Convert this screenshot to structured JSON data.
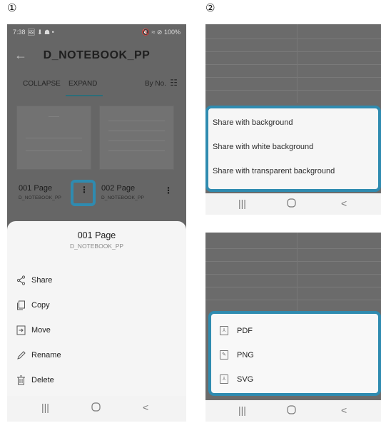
{
  "steps": {
    "one": "①",
    "two": "②"
  },
  "status_bar": {
    "time": "7:38",
    "left_icons": "🖼 ⬇ ☗ •",
    "right_info": "🔇 ≈ ⊘ 100%"
  },
  "app_bar": {
    "back_icon": "back-arrow-icon",
    "title": "D_NOTEBOOK_PP"
  },
  "tabs": {
    "collapse": "COLLAPSE",
    "expand": "EXPAND",
    "sort": "By No."
  },
  "pages": [
    {
      "title": "001 Page",
      "subtitle": "D_NOTEBOOK_PP"
    },
    {
      "title": "002 Page",
      "subtitle": "D_NOTEBOOK_PP"
    }
  ],
  "sheet": {
    "title": "001 Page",
    "subtitle": "D_NOTEBOOK_PP",
    "items": [
      {
        "label": "Share",
        "icon": "share-icon"
      },
      {
        "label": "Copy",
        "icon": "copy-icon"
      },
      {
        "label": "Move",
        "icon": "move-icon"
      },
      {
        "label": "Rename",
        "icon": "rename-icon"
      },
      {
        "label": "Delete",
        "icon": "delete-icon"
      }
    ]
  },
  "share_options": [
    "Share with background",
    "Share with white background",
    "Share with transparent background"
  ],
  "formats": [
    {
      "label": "PDF",
      "icon": "pdf-icon"
    },
    {
      "label": "PNG",
      "icon": "png-icon"
    },
    {
      "label": "SVG",
      "icon": "svg-icon"
    }
  ],
  "colors": {
    "accent": "#2f8bb0",
    "dim_background": "#666666",
    "sheet_background": "#f5f5f5"
  }
}
